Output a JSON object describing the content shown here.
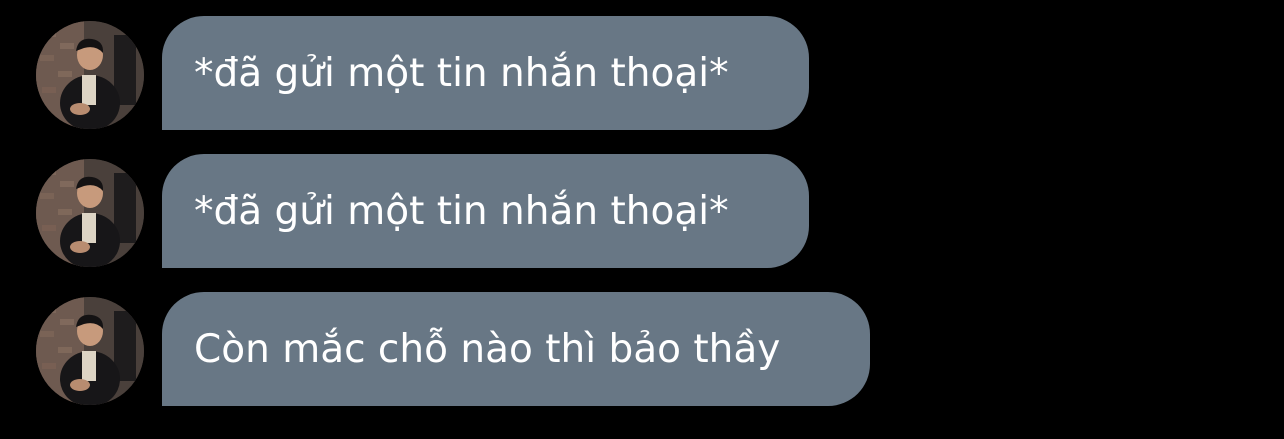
{
  "conversation": {
    "messages": [
      {
        "sender": "avatar",
        "text": "*đã gửi một tin nhắn thoại*"
      },
      {
        "sender": "avatar",
        "text": "*đã gửi một tin nhắn thoại*"
      },
      {
        "sender": "avatar",
        "text": "Còn mắc chỗ nào thì bảo thầy"
      }
    ]
  },
  "colors": {
    "background": "#000000",
    "bubble": "#687785",
    "text": "#ffffff"
  }
}
